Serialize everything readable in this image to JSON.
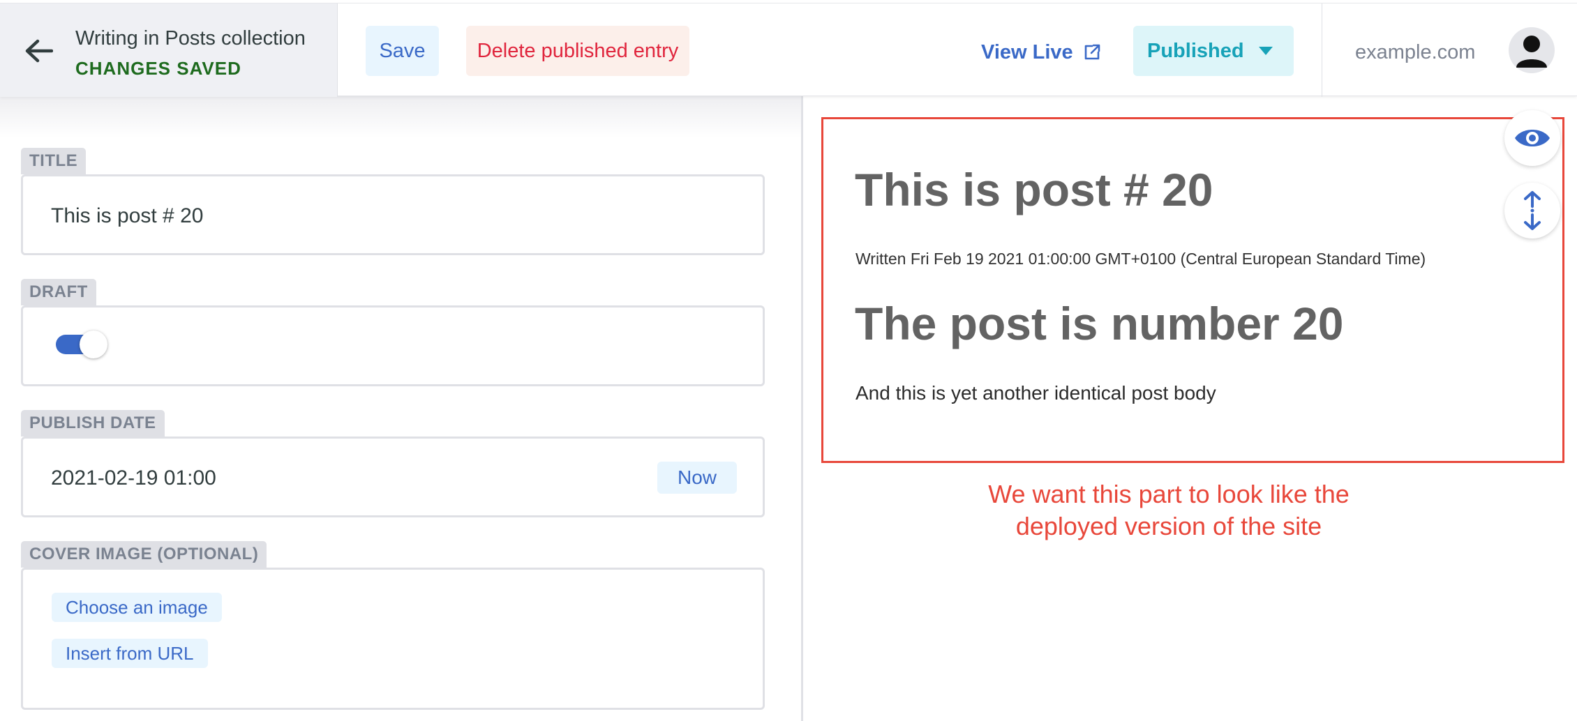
{
  "header": {
    "collection_title": "Writing in Posts collection",
    "save_status": "CHANGES SAVED",
    "save_label": "Save",
    "delete_label": "Delete published entry",
    "view_live_label": "View Live",
    "status_label": "Published",
    "site_url": "example.com"
  },
  "fields": {
    "title": {
      "label": "TITLE",
      "value": "This is post # 20"
    },
    "draft": {
      "label": "DRAFT",
      "checked": true
    },
    "publish_date": {
      "label": "PUBLISH DATE",
      "value": "2021-02-19 01:00",
      "now_label": "Now"
    },
    "cover_image": {
      "label": "COVER IMAGE (OPTIONAL)",
      "choose_label": "Choose an image",
      "url_label": "Insert from URL"
    }
  },
  "preview": {
    "title": "This is post # 20",
    "meta": "Written Fri Feb 19 2021 01:00:00 GMT+0100 (Central European Standard Time)",
    "heading": "The post is number 20",
    "body": "And this is yet another identical post body"
  },
  "annotation": {
    "line1": "We want this part to look like the",
    "line2": "deployed version of the site"
  },
  "colors": {
    "accent": "#3a69c7",
    "danger": "#e0253d",
    "success": "#1e6b1e",
    "published": "#17a2b8",
    "annotation": "#e8473a"
  },
  "icons": {
    "back": "arrow-left-icon",
    "external": "external-link-icon",
    "dropdown": "caret-down-icon",
    "avatar": "user-avatar-icon",
    "preview_toggle": "eye-icon",
    "sync_scroll": "sync-scroll-icon"
  }
}
